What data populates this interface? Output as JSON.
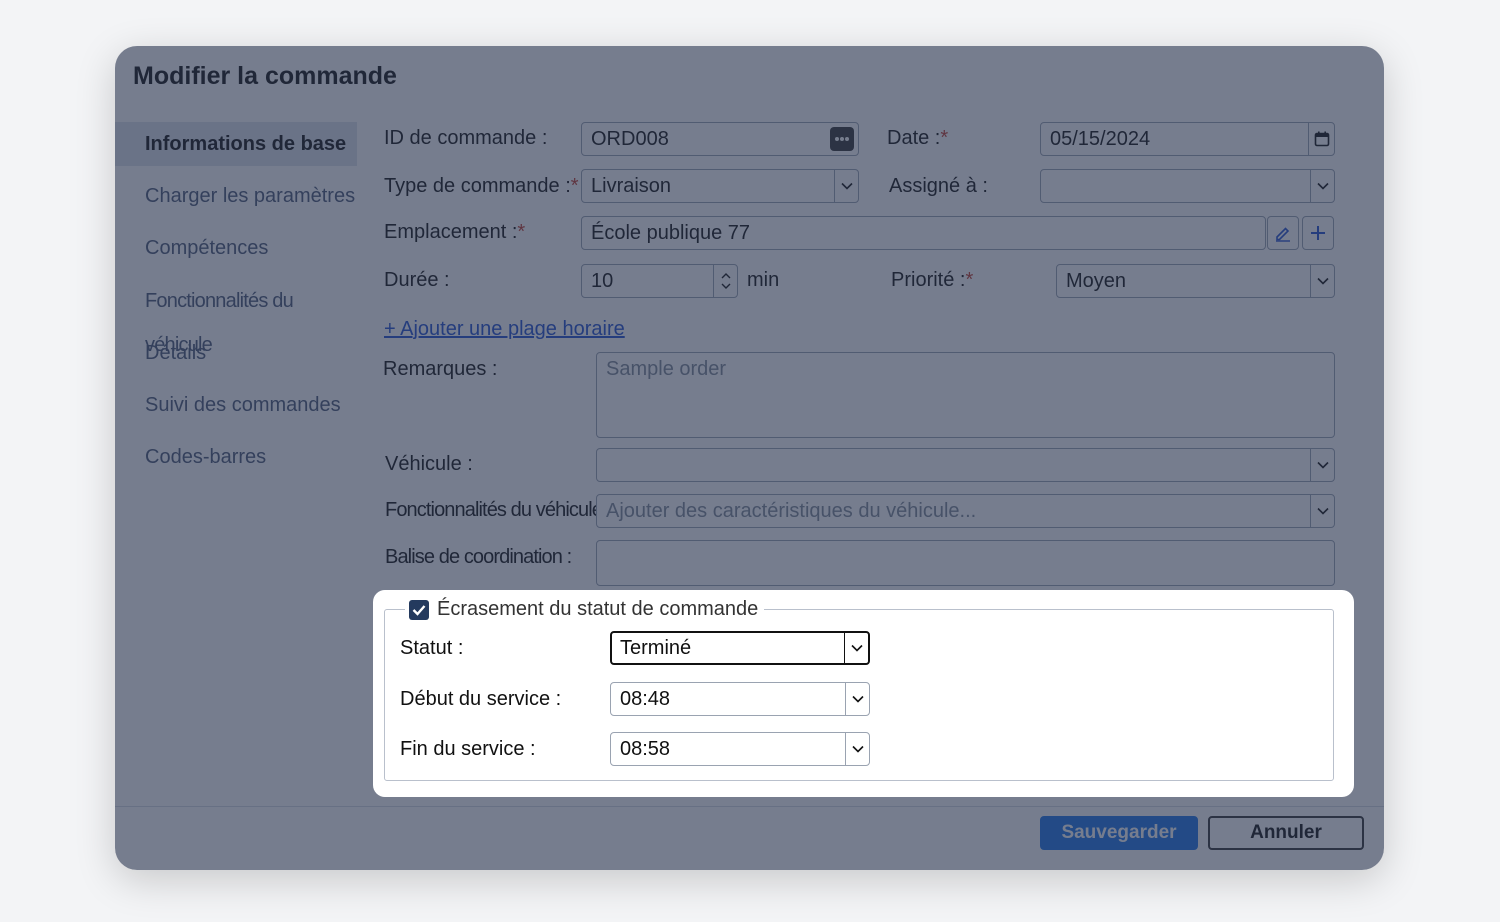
{
  "dialog": {
    "title": "Modifier la commande"
  },
  "sidebar": {
    "items": [
      {
        "label": "Informations de base",
        "active": true
      },
      {
        "label": "Charger les paramètres"
      },
      {
        "label": "Compétences"
      },
      {
        "label": "Fonctionnalités du véhicule"
      },
      {
        "label": "Détails"
      },
      {
        "label": "Suivi des commandes"
      },
      {
        "label": "Codes-barres"
      }
    ]
  },
  "form": {
    "order_id": {
      "label": "ID de commande :",
      "value": "ORD008"
    },
    "date": {
      "label": "Date :",
      "required": "*",
      "value": "05/15/2024"
    },
    "order_type": {
      "label": "Type de commande :",
      "required": "*",
      "value": "Livraison"
    },
    "assigned_to": {
      "label": "Assigné à :",
      "value": ""
    },
    "location": {
      "label": "Emplacement :",
      "required": "*",
      "value": "École publique 77"
    },
    "duration": {
      "label": "Durée :",
      "value": "10",
      "unit": "min"
    },
    "priority": {
      "label": "Priorité :",
      "required": "*",
      "value": "Moyen"
    },
    "add_time_window": "+ Ajouter une plage horaire",
    "remarks": {
      "label": "Remarques :",
      "placeholder": "Sample order"
    },
    "vehicle": {
      "label": "Véhicule :",
      "value": ""
    },
    "vehicle_features": {
      "label": "Fonctionnalités du véhicule :",
      "placeholder": "Ajouter des caractéristiques du véhicule..."
    },
    "coordination_tag": {
      "label": "Balise de coordination :",
      "value": ""
    }
  },
  "status_override": {
    "legend": "Écrasement du statut de commande",
    "checked": true,
    "status": {
      "label": "Statut :",
      "value": "Terminé"
    },
    "service_start": {
      "label": "Début du service :",
      "value": "08:48"
    },
    "service_end": {
      "label": "Fin du service :",
      "value": "08:58"
    }
  },
  "footer": {
    "save": "Sauvegarder",
    "cancel": "Annuler"
  },
  "colors": {
    "accent": "#1a73e8",
    "required": "#c0392b",
    "link": "#1f4fd1",
    "overlay": "#28344e"
  }
}
